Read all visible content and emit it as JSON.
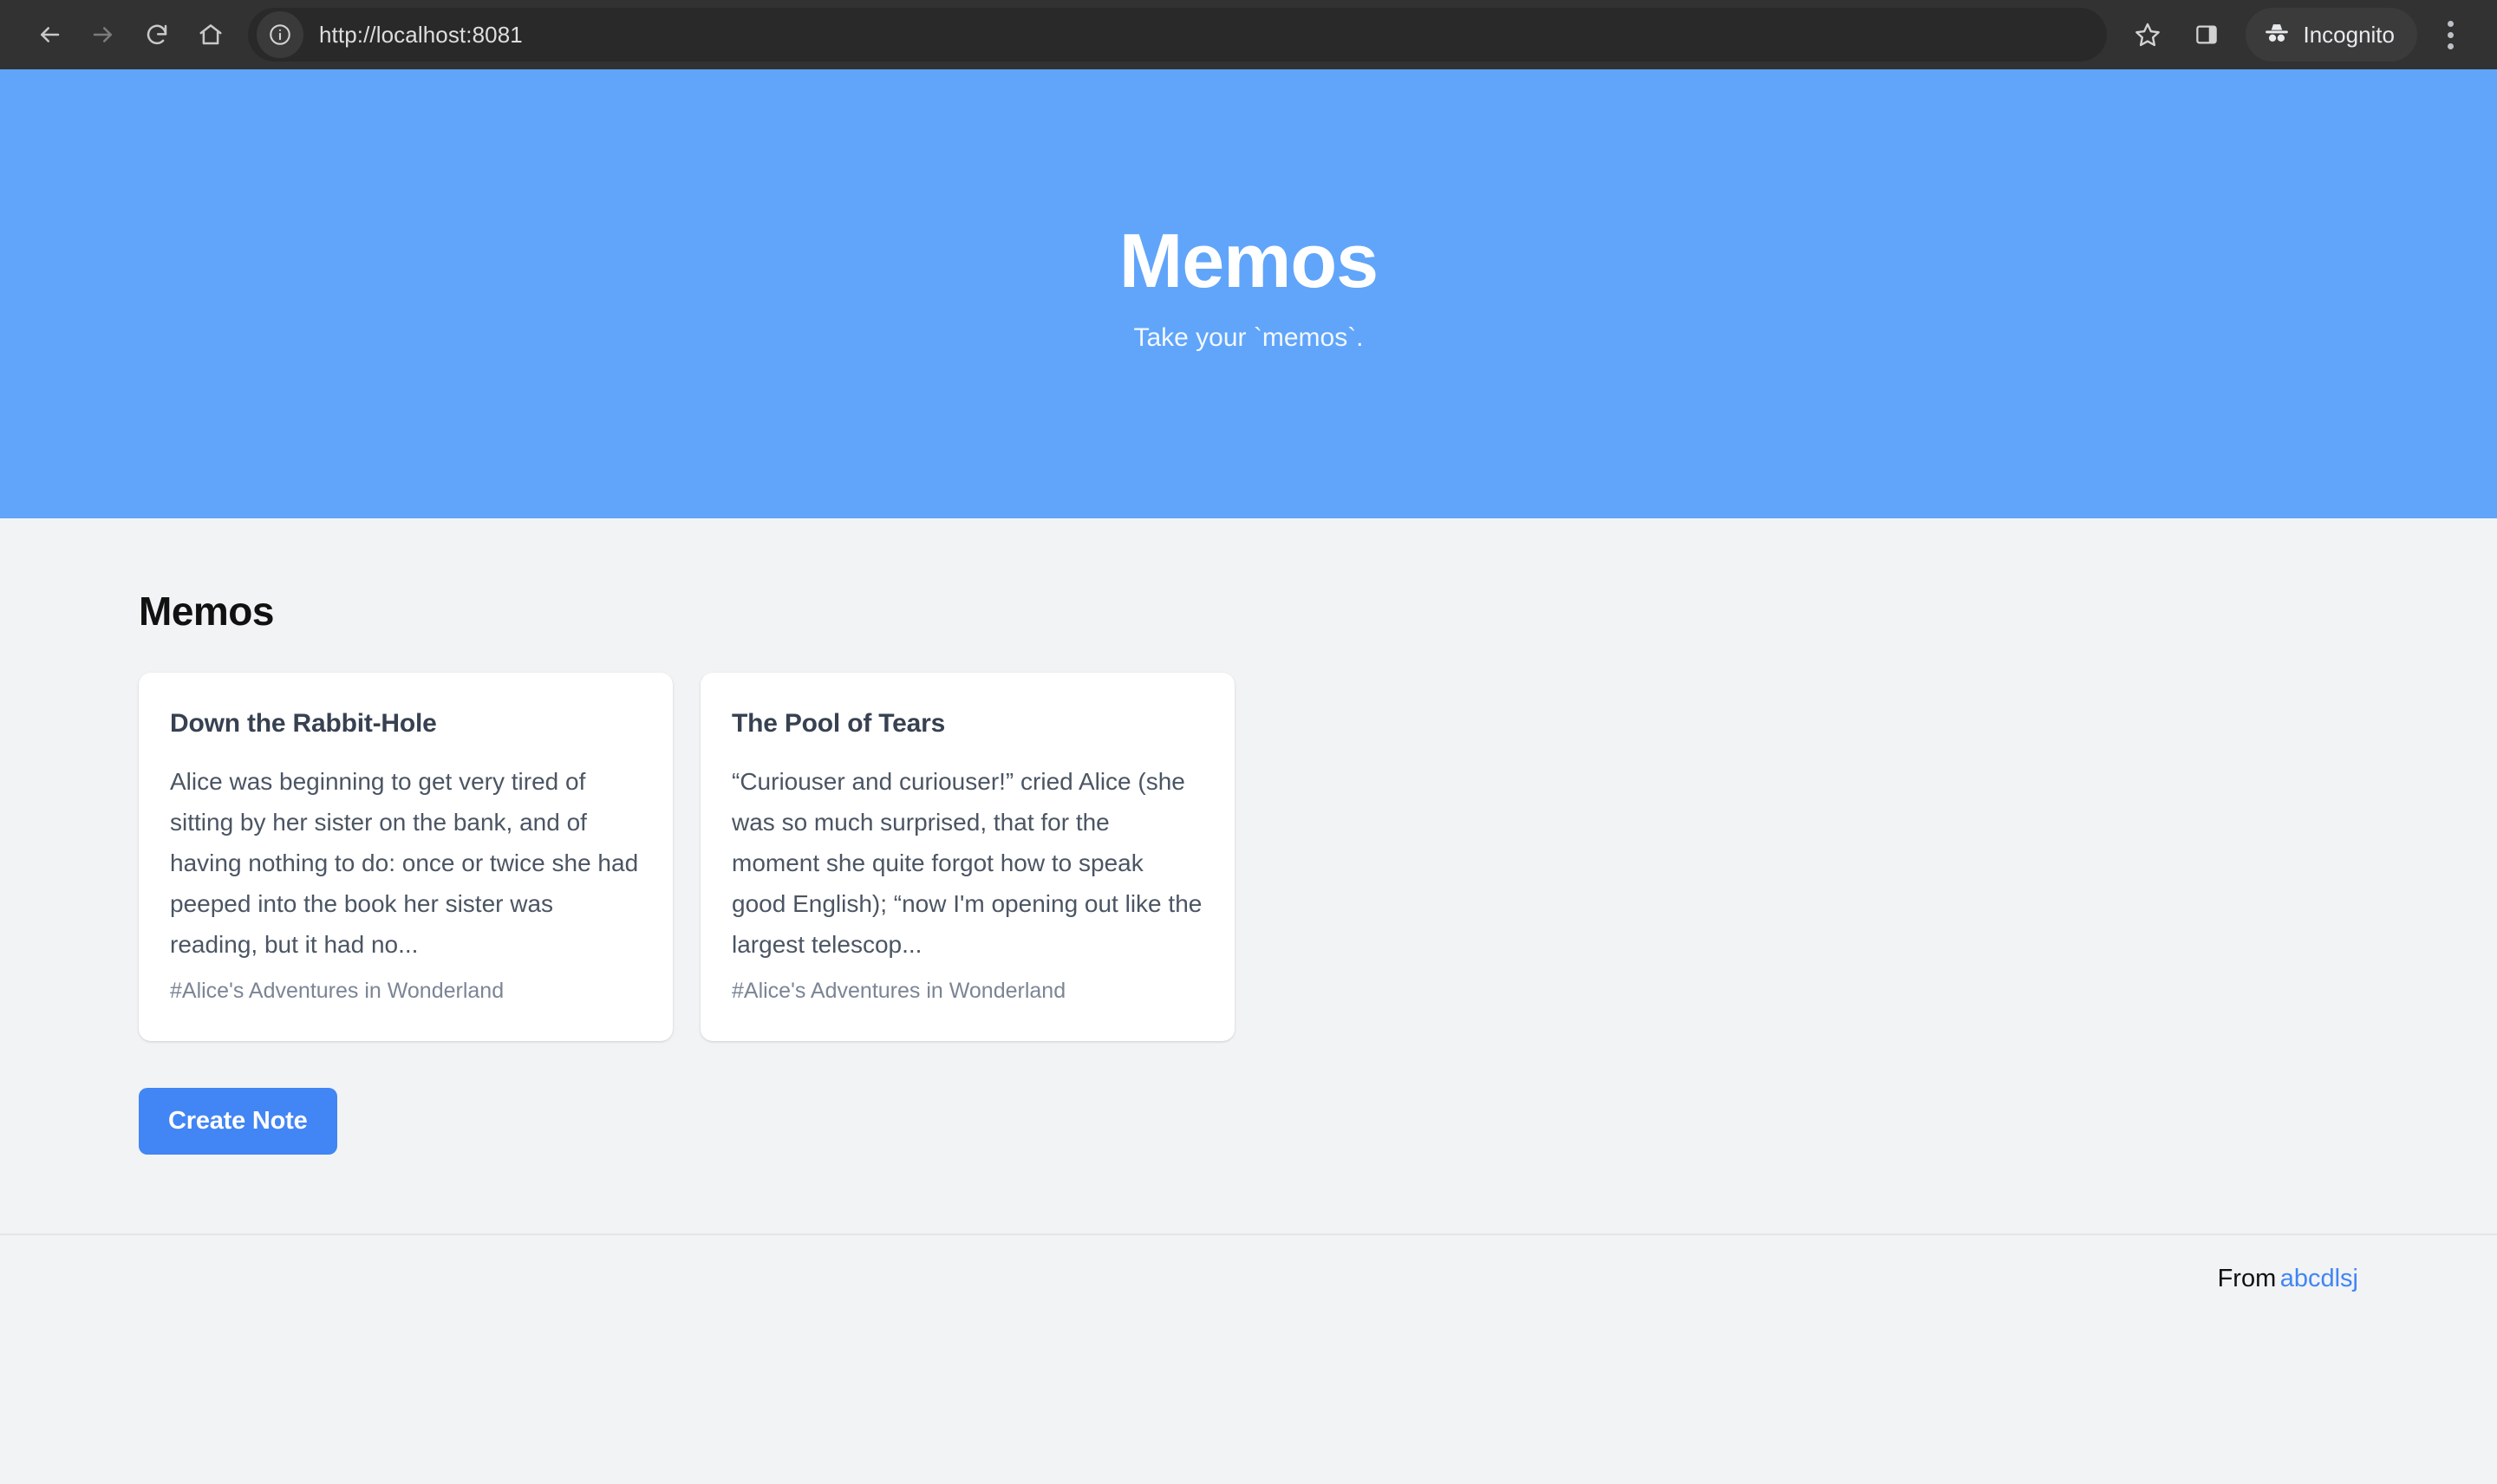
{
  "browser": {
    "nav": {
      "back": "back-arrow",
      "forward": "forward-arrow",
      "reload": "reload",
      "home": "home"
    },
    "omnibox": {
      "url": "http://localhost:8081",
      "site_info_icon": "info-circle-icon"
    },
    "bookmark_icon": "star-icon",
    "side_panel_icon": "side-panel-icon",
    "profile": {
      "label": "Incognito",
      "icon": "incognito-icon"
    },
    "menu_icon": "three-dot-menu-icon"
  },
  "hero": {
    "title": "Memos",
    "subtitle": "Take your `memos`.",
    "background_color": "#60a5fa"
  },
  "main": {
    "section_title": "Memos",
    "notes": [
      {
        "title": "Down the Rabbit-Hole",
        "body": "Alice was beginning to get very tired of sitting by her sister on the bank, and of having nothing to do: once or twice she had peeped into the book her sister was reading, but it had no...",
        "tag": "#Alice's Adventures in Wonderland"
      },
      {
        "title": "The Pool of Tears",
        "body": "“Curiouser and curiouser!” cried Alice (she was so much surprised, that for the moment she quite forgot how to speak good English); “now I'm opening out like the largest telescop...",
        "tag": "#Alice's Adventures in Wonderland"
      }
    ],
    "create_button": "Create Note",
    "accent_color": "#4285f4"
  },
  "footer": {
    "prefix": "From",
    "link_label": "abcdlsj",
    "link_color": "#4285f4"
  }
}
